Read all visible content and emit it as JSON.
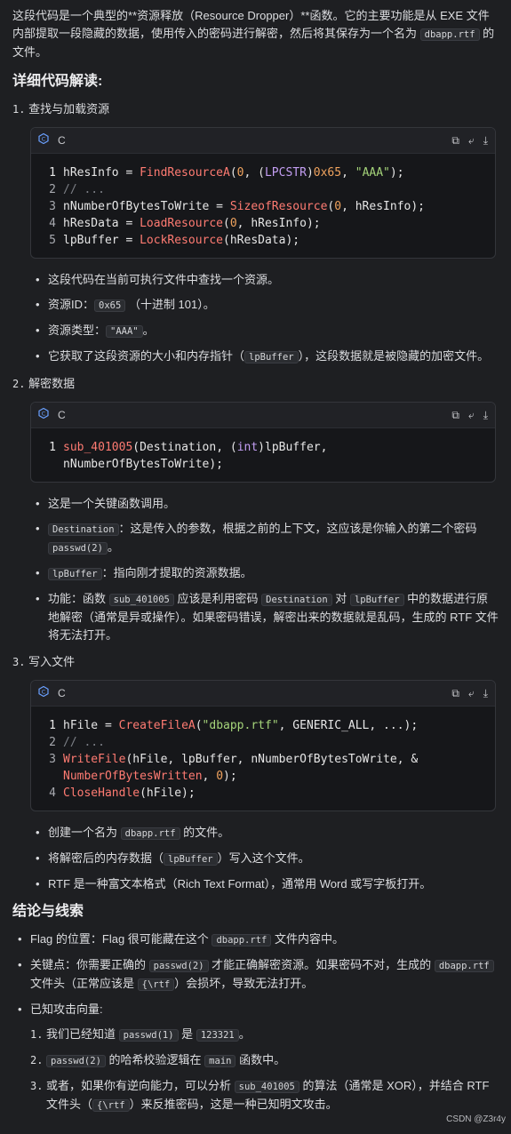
{
  "intro": {
    "text_a": "这段代码是一个典型的**资源释放（Resource Dropper）**函数。它的主要功能是从 EXE 文件内部提取一段隐藏的数据，使用传入的密码进行解密，然后将其保存为一个名为",
    "code_a": "dbapp.rtf",
    "text_b": " 的文件。"
  },
  "heading_detail": "详细代码解读:",
  "section1": {
    "num": "1.",
    "title": "查找与加载资源",
    "lang": "C",
    "bullets": {
      "b1": "这段代码在当前可执行文件中查找一个资源。",
      "b2_a": "资源ID：",
      "b2_code": "0x65",
      "b2_b": "（十进制 101）。",
      "b3_a": "资源类型：",
      "b3_code": "\"AAA\"",
      "b3_b": "。",
      "b4_a": "它获取了这段资源的大小和内存指针（",
      "b4_code": "lpBuffer",
      "b4_b": "），这段数据就是被隐藏的加密文件。"
    }
  },
  "section2": {
    "num": "2.",
    "title": "解密数据",
    "lang": "C",
    "bullets": {
      "b1": "这是一个关键函数调用。",
      "b2_code": "Destination",
      "b2_a": "：这是传入的参数，根据之前的上下文，这应该是你输入的第二个密码",
      "b2_code2": "passwd(2)",
      "b2_b": "。",
      "b3_code": "lpBuffer",
      "b3_a": "：指向刚才提取的资源数据。",
      "b4_a": "功能：函数",
      "b4_code": "sub_401005",
      "b4_b": "应该是利用密码",
      "b4_code2": "Destination",
      "b4_c": "对",
      "b4_code3": "lpBuffer",
      "b4_d": "中的数据进行原地解密（通常是异或操作）。如果密码错误，解密出来的数据就是乱码，生成的 RTF 文件将无法打开。"
    }
  },
  "section3": {
    "num": "3.",
    "title": "写入文件",
    "lang": "C",
    "bullets": {
      "b1_a": "创建一个名为",
      "b1_code": "dbapp.rtf",
      "b1_b": "的文件。",
      "b2_a": "将解密后的内存数据（",
      "b2_code": "lpBuffer",
      "b2_b": "）写入这个文件。",
      "b3": "RTF 是一种富文本格式（Rich Text Format），通常用 Word 或写字板打开。"
    }
  },
  "heading_conclusion": "结论与线索",
  "conclusion": {
    "c1_a": "Flag 的位置：Flag 很可能藏在这个",
    "c1_code": "dbapp.rtf",
    "c1_b": "文件内容中。",
    "c2_a": "关键点：你需要正确的",
    "c2_code": "passwd(2)",
    "c2_b": "才能正确解密资源。如果密码不对，生成的",
    "c2_code2": "dbapp.rtf",
    "c2_c": "文件头（正常应该是",
    "c2_code3": "{\\rtf",
    "c2_d": "）会损坏，导致无法打开。",
    "c3": "已知攻击向量:",
    "sub": {
      "s1_num": "1.",
      "s1_a": "我们已经知道",
      "s1_code": "passwd(1)",
      "s1_b": "是",
      "s1_code2": "123321",
      "s1_c": "。",
      "s2_num": "2.",
      "s2_code": "passwd(2)",
      "s2_a": "的哈希校验逻辑在",
      "s2_code2": "main",
      "s2_b": "函数中。",
      "s3_num": "3.",
      "s3_a": "或者，如果你有逆向能力，可以分析",
      "s3_code": "sub_401005",
      "s3_b": "的算法（通常是 XOR），并结合 RTF 文件头（",
      "s3_code2": "{\\rtf",
      "s3_c": "）来反推密码，这是一种已知明文攻击。"
    }
  },
  "watermark": "CSDN @Z3r4y"
}
